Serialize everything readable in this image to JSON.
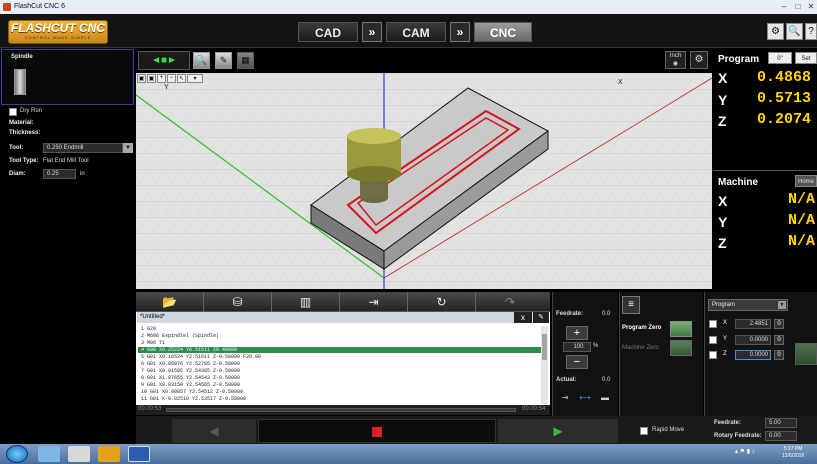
{
  "window": {
    "title": "FlashCut CNC 6"
  },
  "logo": {
    "name": "FLASHCUT CNC",
    "tagline": "CONTROL MADE SIMPLE"
  },
  "modes": [
    {
      "label": "CAD"
    },
    {
      "label": "CAM"
    },
    {
      "label": "CNC"
    }
  ],
  "mode_arrow": "»",
  "left": {
    "title": "Spindle",
    "dry_run": "Dry Run",
    "material": "Material:",
    "thickness": "Thickness:",
    "tool_label": "Tool:",
    "tool_value": "0.250 Endmill",
    "tool_type_label": "Tool Type:",
    "tool_type_value": "Flat End Mill Tool",
    "diam_label": "Diam:",
    "diam_value": "0.25",
    "diam_unit": "in"
  },
  "view": {
    "inch_label": "Inch",
    "x_axis_label": "X",
    "y_axis_label": "Y"
  },
  "program_panel": {
    "title": "Program",
    "zero_btn": "0\"",
    "set_btn": "Set",
    "x_label": "X",
    "x_value": "0.4868",
    "y_label": "Y",
    "y_value": "0.5713",
    "z_label": "Z",
    "z_value": "0.2074"
  },
  "machine_panel": {
    "title": "Machine",
    "home_btn": "Home",
    "x_label": "X",
    "x_value": "N/A",
    "y_label": "Y",
    "y_value": "N/A",
    "z_label": "Z",
    "z_value": "N/A"
  },
  "editor": {
    "filename": "*Untitled*",
    "close": "x",
    "lines": [
      "1 G20",
      "2 M606 Espindlel (Spindle)",
      "3 M06 T1",
      "4 G00 X0.25224 Y0.51511 Z0.40000",
      "5 G01 X0.16524 Y2.51611 Z-0.50000 F20.00",
      "6 G01 X0.05076 Y2.52705 Z-0.50000",
      "7 G01 X0.01505 Y2.54305 Z-0.50000",
      "8 G01 X1.97655 Y2.54543 Z-0.50000",
      "9 G01 X0.03150 Y2.54565 Z-0.50000",
      "10 G01 X0.00057 Y2.54512 Z-0.50000",
      "11 G01 X-0.02510 Y2.53517 Z-0.50000"
    ],
    "time_start": "00:00:53",
    "time_end": "00:00:54"
  },
  "feed": {
    "label": "Feedrate:",
    "value": "0.0",
    "plus": "+",
    "minus": "−",
    "pct_value": "100",
    "pct_unit": "%",
    "actual_label": "Actual:",
    "actual_value": "0.0"
  },
  "zero": {
    "program_zero": "Program Zero",
    "machine_zero": "Machine Zero"
  },
  "prog_select": {
    "value": "Program",
    "rows": [
      {
        "axis": "X",
        "value": "2.4851",
        "zero": "0"
      },
      {
        "axis": "Y",
        "value": "0.0000",
        "zero": "0"
      },
      {
        "axis": "Z",
        "value": "0.0000",
        "zero": "0"
      }
    ]
  },
  "bottom": {
    "rapid_move": "Rapid Move",
    "feedrate_label": "Feedrate:",
    "feedrate_value": "5.00",
    "rotary_label": "Rotary Feedrate:",
    "rotary_value": "0.00"
  },
  "taskbar": {
    "time": "5:17 PM",
    "date": "12/6/2016"
  },
  "colors": {
    "accent_yellow": "#ffd500",
    "selection_green": "#2f8a4b",
    "toolpath_red": "#d6141c",
    "logo_orange": "#e3a02a"
  }
}
